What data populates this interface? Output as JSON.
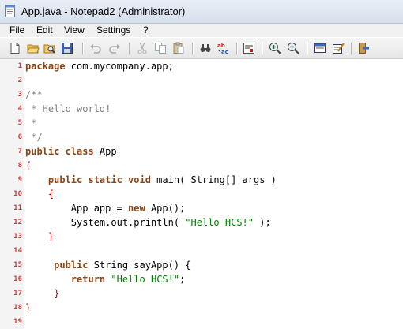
{
  "window": {
    "title": "App.java - Notepad2 (Administrator)"
  },
  "menu": [
    "File",
    "Edit",
    "View",
    "Settings",
    "?"
  ],
  "toolbar": {
    "buttons": [
      {
        "name": "new-file-icon"
      },
      {
        "name": "open-file-icon"
      },
      {
        "name": "browse-icon"
      },
      {
        "name": "save-icon"
      },
      {
        "name": "undo-icon"
      },
      {
        "name": "redo-icon"
      },
      {
        "name": "cut-icon"
      },
      {
        "name": "copy-icon"
      },
      {
        "name": "paste-icon"
      },
      {
        "name": "find-icon"
      },
      {
        "name": "replace-icon"
      },
      {
        "name": "word-wrap-icon"
      },
      {
        "name": "zoom-in-icon"
      },
      {
        "name": "zoom-out-icon"
      },
      {
        "name": "scheme-icon"
      },
      {
        "name": "customize-scheme-icon"
      },
      {
        "name": "exit-icon"
      }
    ]
  },
  "editor": {
    "line_numbers": [
      "1",
      "2",
      "3",
      "4",
      "5",
      "6",
      "7",
      "8",
      "9",
      "10",
      "11",
      "12",
      "13",
      "14",
      "15",
      "16",
      "17",
      "18",
      "19"
    ],
    "tokens": {
      "package_kw": "package",
      "package_name": " com.mycompany.app;",
      "c_open": "/**",
      "c_hello": " * Hello world!",
      "c_star": " *",
      "c_close": " */",
      "public_class": "public class",
      "class_name": " App",
      "brace_open": "{",
      "brace_close": "}",
      "main_indent": "    ",
      "main_kw": "public static void",
      "main_sig": " main( String[] args )",
      "inner_indent": "    {",
      "new_line_a": "        App app = ",
      "new_kw": "new",
      "new_line_b": " App();",
      "println_a": "        System.out.println( ",
      "println_str": "\"Hello HCS!\"",
      "println_b": " );",
      "inner_close": "    }",
      "say_indent": "     ",
      "say_kw": "public",
      "say_sig": " String sayApp() {",
      "ret_indent": "        ",
      "ret_kw": "return",
      "ret_sp": " ",
      "ret_str": "\"Hello HCS!\"",
      "ret_end": ";",
      "say_close": "     }"
    }
  },
  "colors": {
    "keyword": "#8b4513",
    "comment": "#808080",
    "string": "#008000",
    "line_number": "#c04040"
  }
}
